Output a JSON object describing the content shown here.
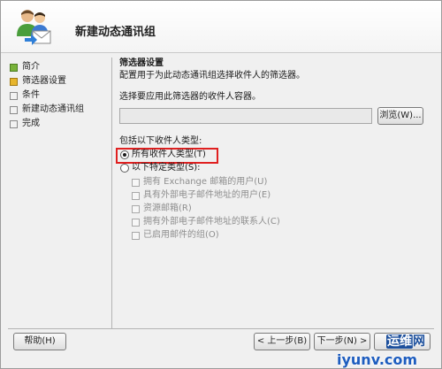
{
  "header": {
    "title": "新建动态通讯组"
  },
  "nav": {
    "items": [
      {
        "label": "简介",
        "state": "done"
      },
      {
        "label": "筛选器设置",
        "state": "active"
      },
      {
        "label": "条件",
        "state": "pending"
      },
      {
        "label": "新建动态通讯组",
        "state": "pending"
      },
      {
        "label": "完成",
        "state": "pending"
      }
    ]
  },
  "filter": {
    "title": "筛选器设置",
    "description": "配置用于为此动态通讯组选择收件人的筛选器。",
    "container_label": "选择要应用此筛选器的收件人容器。",
    "container_value": "",
    "browse_label": "浏览(W)...",
    "include_label": "包括以下收件人类型:",
    "radio_all": "所有收件人类型(T)",
    "radio_specific": "以下特定类型(S):",
    "checkboxes": [
      {
        "label": "拥有 Exchange 邮箱的用户(U)",
        "checked": false,
        "enabled": false
      },
      {
        "label": "具有外部电子邮件地址的用户(E)",
        "checked": false,
        "enabled": false
      },
      {
        "label": "资源邮箱(R)",
        "checked": false,
        "enabled": false
      },
      {
        "label": "拥有外部电子邮件地址的联系人(C)",
        "checked": false,
        "enabled": false
      },
      {
        "label": "已启用邮件的组(O)",
        "checked": false,
        "enabled": false
      }
    ]
  },
  "buttons": {
    "help": "帮助(H)",
    "back": "< 上一步(B)",
    "next": "下一步(N) >"
  },
  "watermark": {
    "logo_badge": "运维",
    "logo_text": "网",
    "url": "iyunv.com"
  },
  "colors": {
    "highlight": "#e02020",
    "step_done": "#78b23a",
    "step_active": "#e7b52c",
    "watermark": "#1e5dbf"
  }
}
